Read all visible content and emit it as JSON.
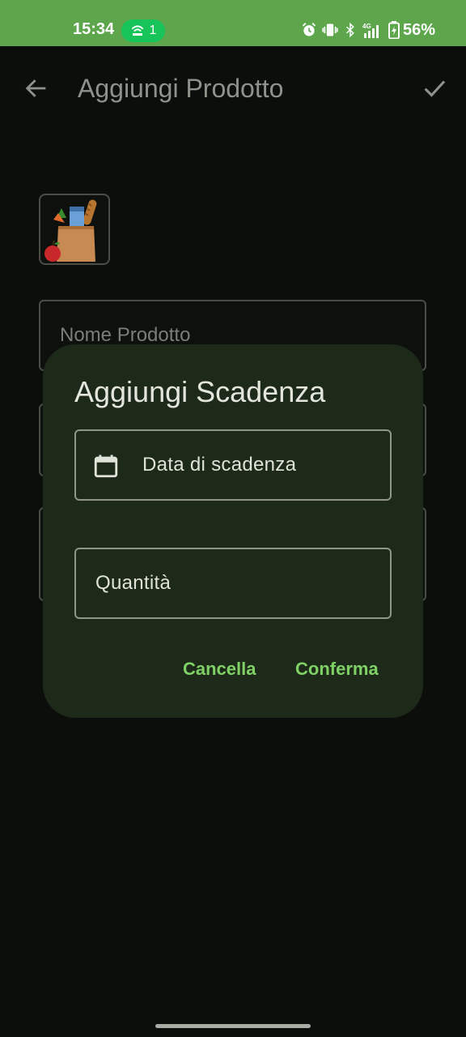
{
  "status_bar": {
    "time": "15:34",
    "hotspot_count": "1",
    "battery": "56%",
    "icons": [
      "alarm-icon",
      "vibrate-icon",
      "bluetooth-icon",
      "signal-4g-icon",
      "battery-icon"
    ]
  },
  "topbar": {
    "title": "Aggiungi Prodotto",
    "back_icon": "arrow-back-icon",
    "confirm_icon": "check-icon"
  },
  "form": {
    "product_image": "grocery-bag-icon",
    "name_label": "Nome Prodotto"
  },
  "dialog": {
    "title": "Aggiungi Scadenza",
    "date_label": "Data di scadenza",
    "date_icon": "calendar-icon",
    "quantity_label": "Quantità",
    "cancel_label": "Cancella",
    "confirm_label": "Conferma"
  },
  "colors": {
    "status_bar": "#5da64c",
    "hotspot_pill": "#17c45a",
    "dialog_bg": "#1d2a1a",
    "accent": "#7fd166",
    "background": "#0c0e0c"
  }
}
